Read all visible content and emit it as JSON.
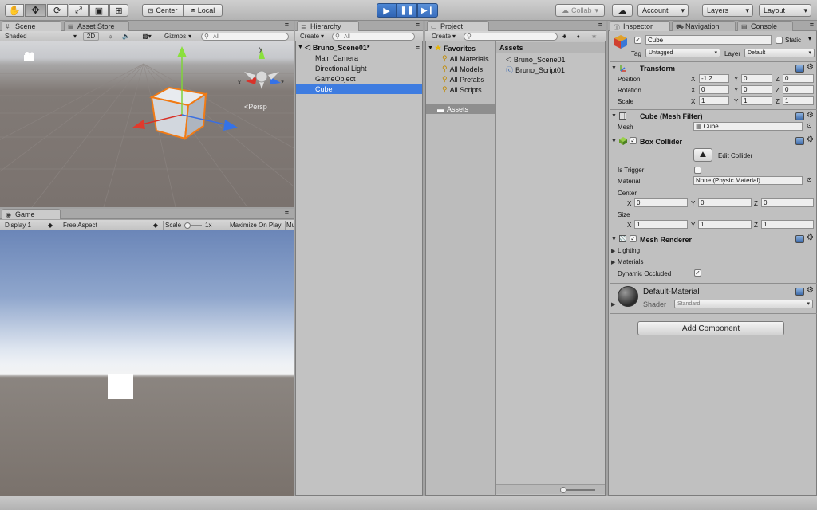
{
  "toolbar": {
    "pivot_label": "Center",
    "space_label": "Local",
    "collab_label": "Collab",
    "account_label": "Account",
    "layers_label": "Layers",
    "layout_label": "Layout"
  },
  "scene": {
    "tab_label": "Scene",
    "asset_store_label": "Asset Store",
    "shading": "Shaded",
    "mode_2d": "2D",
    "gizmos_label": "Gizmos",
    "search_placeholder": "All",
    "persp_label": "Persp",
    "axis_x": "x",
    "axis_z": "z"
  },
  "game": {
    "tab_label": "Game",
    "display": "Display 1",
    "aspect": "Free Aspect",
    "scale_label": "Scale",
    "scale_value": "1x",
    "maximize_label": "Maximize On Play",
    "more_label": "Mu"
  },
  "hierarchy": {
    "tab_label": "Hierarchy",
    "create_label": "Create",
    "search_placeholder": "All",
    "scene_name": "Bruno_Scene01*",
    "items": [
      "Main Camera",
      "Directional Light",
      "GameObject",
      "Cube"
    ],
    "selected": "Cube"
  },
  "project": {
    "tab_label": "Project",
    "create_label": "Create",
    "favorites_label": "Favorites",
    "favorites": [
      "All Materials",
      "All Models",
      "All Prefabs",
      "All Scripts"
    ],
    "assets_folder": "Assets",
    "assets_header": "Assets",
    "assets": [
      "Bruno_Scene01",
      "Bruno_Script01"
    ]
  },
  "inspector": {
    "tabs": [
      "Inspector",
      "Navigation",
      "Console"
    ],
    "object_name": "Cube",
    "static_label": "Static",
    "tag_label": "Tag",
    "tag_value": "Untagged",
    "layer_label": "Layer",
    "layer_value": "Default",
    "transform": {
      "title": "Transform",
      "position_label": "Position",
      "rotation_label": "Rotation",
      "scale_label": "Scale",
      "position": {
        "x": "-1.2",
        "y": "0",
        "z": "0"
      },
      "rotation": {
        "x": "0",
        "y": "0",
        "z": "0"
      },
      "scale": {
        "x": "1",
        "y": "1",
        "z": "1"
      }
    },
    "mesh_filter": {
      "title": "Cube (Mesh Filter)",
      "mesh_label": "Mesh",
      "mesh_value": "Cube"
    },
    "box_collider": {
      "title": "Box Collider",
      "edit_label": "Edit Collider",
      "is_trigger_label": "Is Trigger",
      "material_label": "Material",
      "material_value": "None (Physic Material)",
      "center_label": "Center",
      "size_label": "Size",
      "center": {
        "x": "0",
        "y": "0",
        "z": "0"
      },
      "size": {
        "x": "1",
        "y": "1",
        "z": "1"
      }
    },
    "mesh_renderer": {
      "title": "Mesh Renderer",
      "lighting_label": "Lighting",
      "materials_label": "Materials",
      "dynamic_occluded_label": "Dynamic Occluded"
    },
    "material": {
      "name": "Default-Material",
      "shader_label": "Shader",
      "shader_value": "Standard"
    },
    "add_component_label": "Add Component",
    "axis_x": "X",
    "axis_y": "Y",
    "axis_z": "Z"
  },
  "colors": {
    "selection": "#3e7ce0",
    "play_button_bg": "#3d76c8",
    "scene_sky": "#c9cbcf",
    "scene_ground": "#7b736e",
    "game_sky": "#6b86b8",
    "game_ground": "#7a726c",
    "cube_outline": "#f07b16"
  }
}
